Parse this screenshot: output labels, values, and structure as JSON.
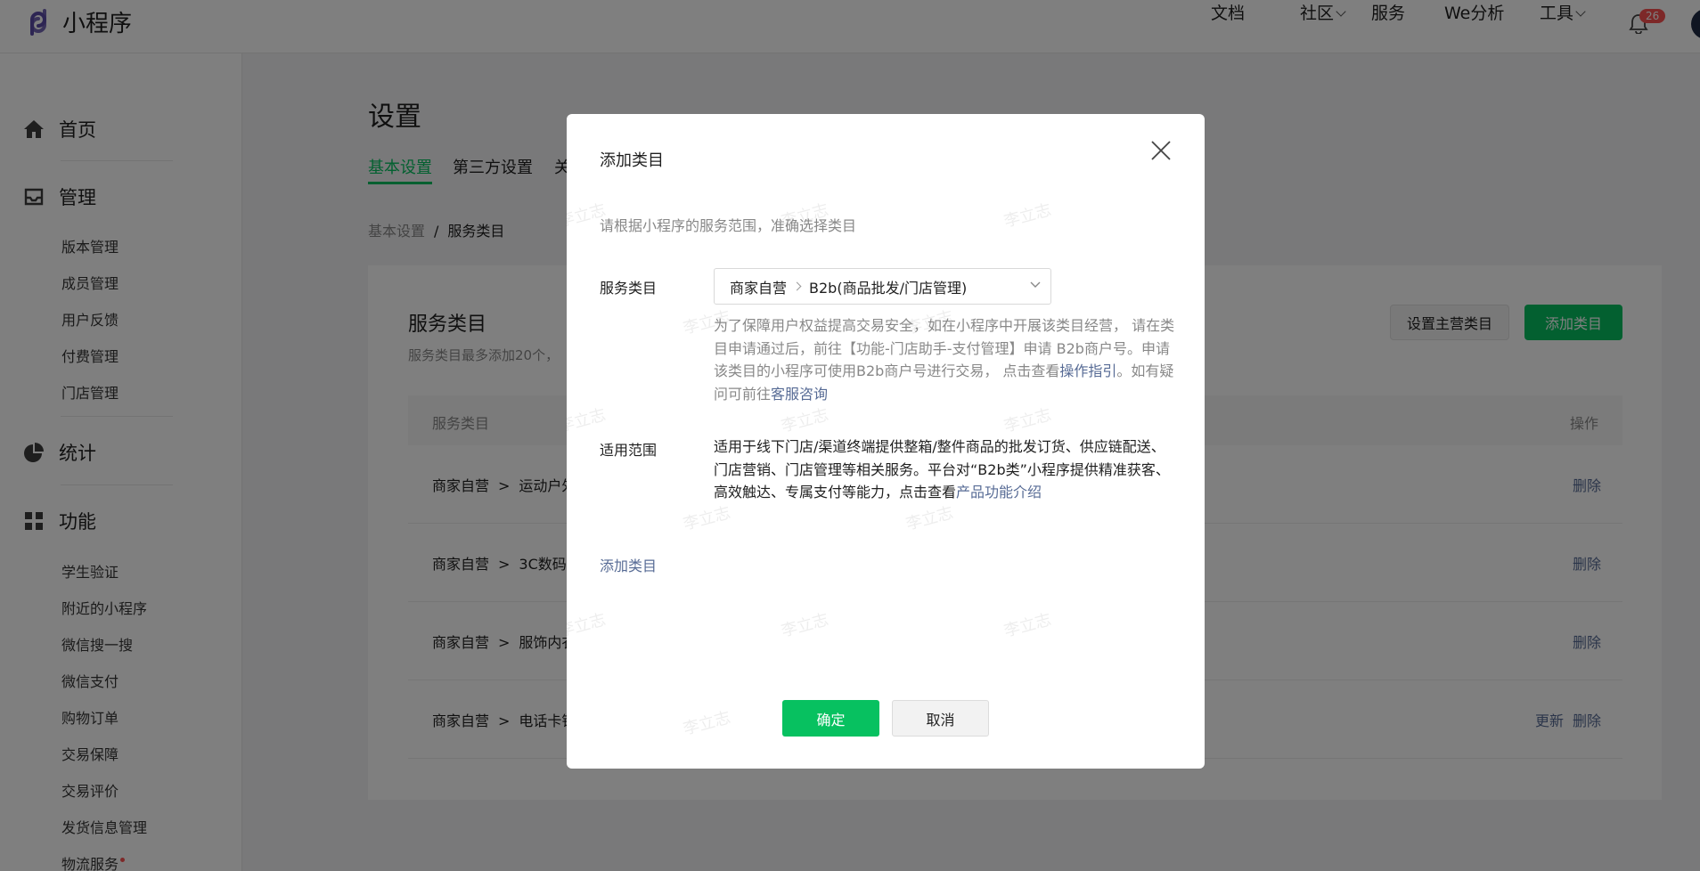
{
  "header": {
    "app_name": "小程序",
    "nav": [
      "文档",
      "社区",
      "服务",
      "We分析",
      "工具"
    ],
    "notification_count": "26"
  },
  "sidebar": {
    "home": "首页",
    "manage": "管理",
    "manage_items": [
      "版本管理",
      "成员管理",
      "用户反馈",
      "付费管理",
      "门店管理"
    ],
    "stats": "统计",
    "features": "功能",
    "feature_items": [
      "学生验证",
      "附近的小程序",
      "微信搜一搜",
      "微信支付",
      "购物订单",
      "交易保障",
      "交易评价",
      "发货信息管理",
      "物流服务"
    ]
  },
  "page": {
    "title": "设置",
    "tabs": [
      "基本设置",
      "第三方设置",
      "关"
    ],
    "breadcrumb": [
      "基本设置",
      "/",
      "服务类目"
    ]
  },
  "card": {
    "title": "服务类目",
    "subtitle": "服务类目最多添加20个，",
    "btn_set_main": "设置主营类目",
    "btn_add": "添加类目",
    "columns": [
      "服务类目",
      "操作"
    ],
    "rows": [
      {
        "l1": "商家自营",
        "sep": ">",
        "l2": "运动户外",
        "ops": [
          "删除"
        ]
      },
      {
        "l1": "商家自营",
        "sep": ">",
        "l2": "3C数码",
        "ops": [
          "删除"
        ]
      },
      {
        "l1": "商家自营",
        "sep": ">",
        "l2": "服饰内衣",
        "ops": [
          "删除"
        ]
      },
      {
        "l1": "商家自营",
        "sep": ">",
        "l2": "电话卡销",
        "ops": [
          "更新",
          "删除"
        ]
      }
    ]
  },
  "modal": {
    "title": "添加类目",
    "description": "请根据小程序的服务范围，准确选择类目",
    "category_label": "服务类目",
    "select_l1": "商家自营",
    "select_l2": "B2b(商品批发/门店管理)",
    "notice_text1": "为了保障用户权益提高交易安全，如在小程序中开展该类目经营， 请在类目申请通过后，前往【功能-门店助手-支付管理】申请 B2b商户号。申请该类目的小程序可使用B2b商户号进行交易， 点击查看",
    "notice_link1": "操作指引",
    "notice_text2": "。如有疑问可前往",
    "notice_link2": "客服咨询",
    "scope_label": "适用范围",
    "scope_text": "适用于线下门店/渠道终端提供整箱/整件商品的批发订货、供应链配送、门店营销、门店管理等相关服务。平台对“B2b类”小程序提供精准获客、高效触达、专属支付等能力，点击查看",
    "scope_link": "产品功能介绍",
    "add_link": "添加类目",
    "confirm": "确定",
    "cancel": "取消",
    "watermark": "李立志"
  },
  "colors": {
    "brand_green": "#07c160",
    "link_blue": "#576b95",
    "badge_red": "#fa5151"
  }
}
